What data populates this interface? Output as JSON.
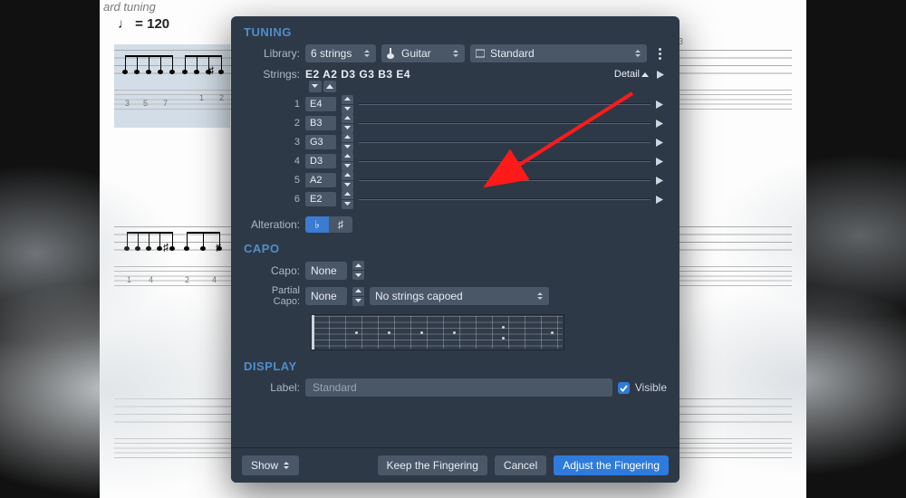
{
  "background": {
    "subtitle_fragment": "ard tuning",
    "tempo_text": "= 120",
    "bar_numbers": [
      "3"
    ],
    "tab_under_sel": [
      "3",
      "5",
      "7",
      "1",
      "2"
    ],
    "tab_row2": [
      "1",
      "4",
      "2",
      "4"
    ]
  },
  "dialog": {
    "tuning": {
      "title": "TUNING",
      "library_label": "Library:",
      "strings_count": "6 strings",
      "instrument": "Guitar",
      "preset": "Standard",
      "strings_label": "Strings:",
      "strings_value": "E2 A2 D3 G3 B3 E4",
      "detail": "Detail",
      "string_rows": [
        {
          "n": "1",
          "p": "E4"
        },
        {
          "n": "2",
          "p": "B3"
        },
        {
          "n": "3",
          "p": "G3"
        },
        {
          "n": "4",
          "p": "D3"
        },
        {
          "n": "5",
          "p": "A2"
        },
        {
          "n": "6",
          "p": "E2"
        }
      ],
      "alteration_label": "Alteration:",
      "flat": "♭",
      "sharp": "♯"
    },
    "capo": {
      "title": "CAPO",
      "capo_label": "Capo:",
      "capo_value": "None",
      "partial_label": "Partial Capo:",
      "partial_value": "None",
      "partial_strings": "No strings capoed"
    },
    "display": {
      "title": "DISPLAY",
      "label_label": "Label:",
      "label_value": "Standard",
      "visible": "Visible"
    },
    "footer": {
      "show": "Show",
      "keep": "Keep the Fingering",
      "cancel": "Cancel",
      "adjust": "Adjust the Fingering"
    }
  }
}
